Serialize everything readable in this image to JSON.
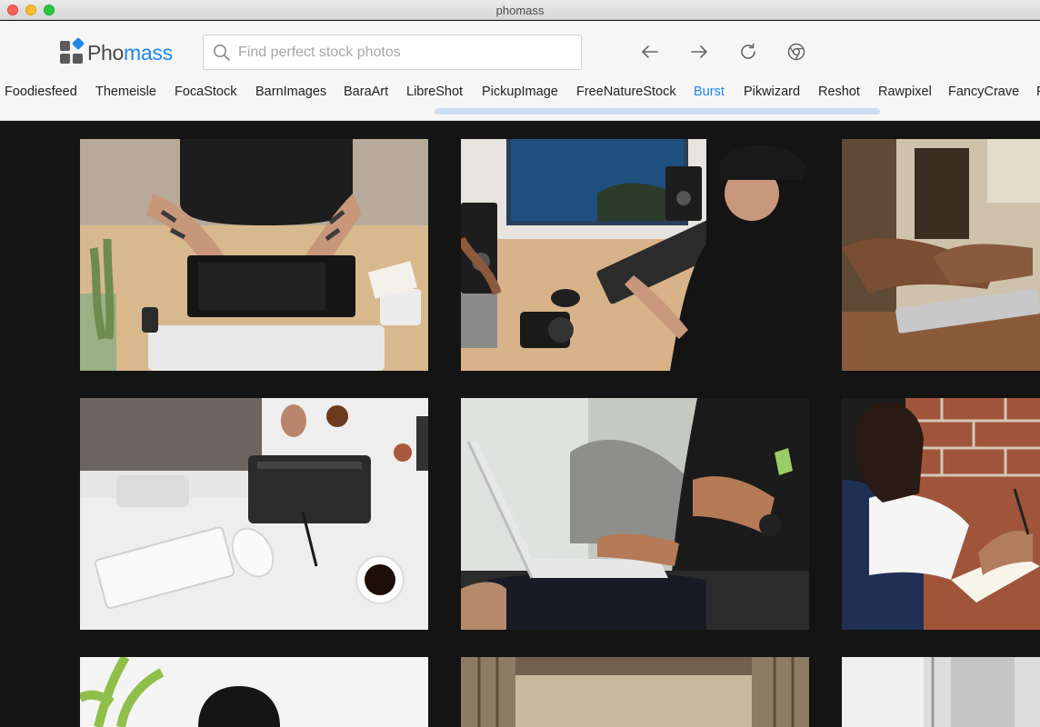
{
  "window": {
    "title": "phomass"
  },
  "app": {
    "logo_part1": "Pho",
    "logo_part2": "mass"
  },
  "search": {
    "placeholder": "Find perfect stock photos",
    "value": ""
  },
  "nav": {
    "back": "arrow-left-icon",
    "forward": "arrow-right-icon",
    "reload": "reload-icon",
    "browser": "browser-icon"
  },
  "sources": {
    "active": "Burst",
    "items": [
      "Foodiesfeed",
      "Themeisle",
      "FocaStock",
      "BarnImages",
      "BaraArt",
      "LibreShot",
      "PickupImage",
      "FreeNatureStock",
      "Burst",
      "Pikwizard",
      "Reshot",
      "Rawpixel",
      "FancyCrave",
      "F"
    ]
  },
  "colors": {
    "accent": "#1e88e5",
    "gallery_bg": "#141414",
    "toolbar_bg": "#f6f6f6"
  },
  "photos": [
    {
      "subject": "tattooed person drawing on graphics tablet at wooden desk"
    },
    {
      "subject": "man with cap working at desk with monitor, keyboard and camera"
    },
    {
      "subject": "hands typing on laptop at wooden table"
    },
    {
      "subject": "top view of white desk with imac, keyboard, tablet and coffee"
    },
    {
      "subject": "man on couch with laptop holding a mug"
    },
    {
      "subject": "woman writing in notebook by brick wall"
    },
    {
      "subject": "plant and woman with curly hair"
    },
    {
      "subject": "room with curtains"
    },
    {
      "subject": "bright room interior"
    }
  ]
}
